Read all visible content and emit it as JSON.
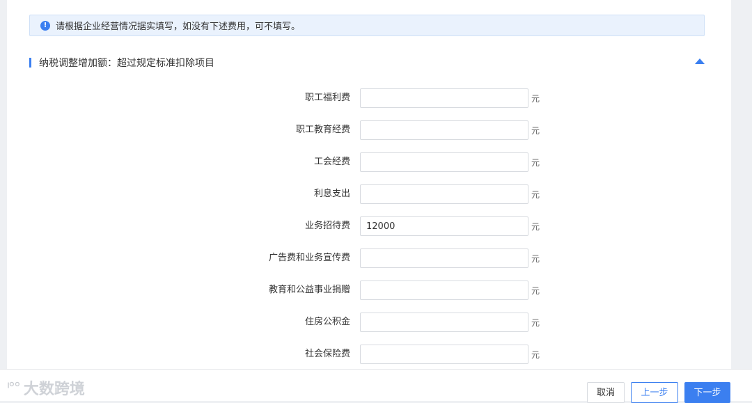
{
  "notice": {
    "icon": "info-icon",
    "text": "请根据企业经营情况据实填写，如没有下述费用，可不填写。"
  },
  "section": {
    "title": "纳税调整增加额：超过规定标准扣除项目",
    "collapse_icon": "caret-up-icon",
    "accent_color": "#3b7ff0"
  },
  "fields": [
    {
      "label": "职工福利费",
      "value": "",
      "unit": "元"
    },
    {
      "label": "职工教育经费",
      "value": "",
      "unit": "元"
    },
    {
      "label": "工会经费",
      "value": "",
      "unit": "元"
    },
    {
      "label": "利息支出",
      "value": "",
      "unit": "元"
    },
    {
      "label": "业务招待费",
      "value": "12000",
      "unit": "元"
    },
    {
      "label": "广告费和业务宣传费",
      "value": "",
      "unit": "元"
    },
    {
      "label": "教育和公益事业捐赠",
      "value": "",
      "unit": "元"
    },
    {
      "label": "住房公积金",
      "value": "",
      "unit": "元"
    },
    {
      "label": "社会保险费",
      "value": "",
      "unit": "元"
    }
  ],
  "footer": {
    "watermark": "大数跨境",
    "cancel_label": "取消",
    "prev_label": "上一步",
    "next_label": "下一步"
  }
}
